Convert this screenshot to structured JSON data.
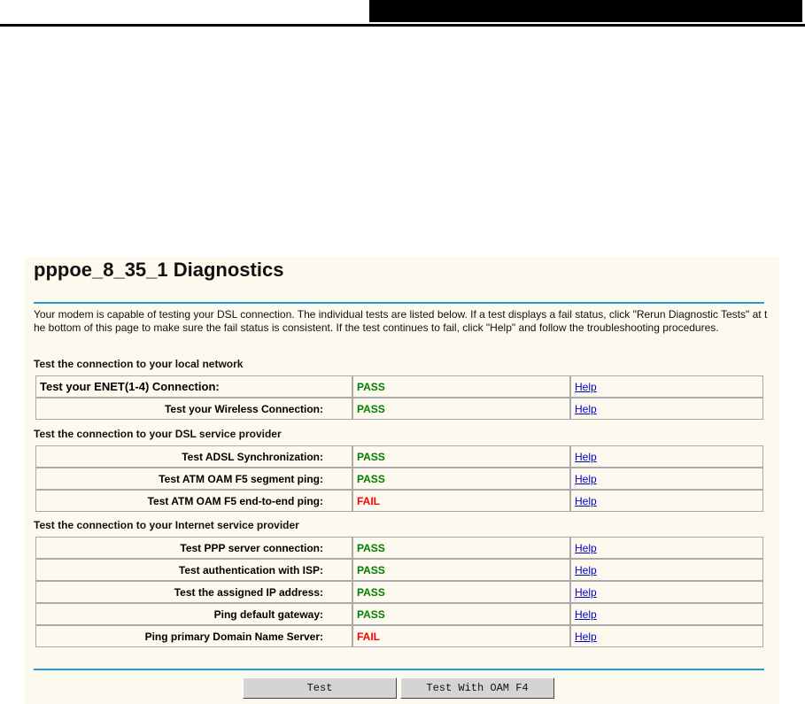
{
  "title": "pppoe_8_35_1 Diagnostics",
  "intro": "Your modem is capable of testing your DSL connection. The individual tests are listed below. If a test displays a fail status, click \"Rerun Diagnostic Tests\" at the bottom of this page to make sure the fail status is consistent. If the test continues to fail, click \"Help\" and follow the troubleshooting procedures.",
  "sections": [
    {
      "heading": "Test the connection to your local network",
      "rows": [
        {
          "label": "Test your ENET(1-4) Connection:",
          "status": "PASS",
          "help": "Help"
        },
        {
          "label": "Test your Wireless Connection:",
          "status": "PASS",
          "help": "Help"
        }
      ]
    },
    {
      "heading": "Test the connection to your DSL service provider",
      "rows": [
        {
          "label": "Test ADSL Synchronization:",
          "status": "PASS",
          "help": "Help"
        },
        {
          "label": "Test ATM OAM F5 segment ping:",
          "status": "PASS",
          "help": "Help"
        },
        {
          "label": "Test ATM OAM F5 end-to-end ping:",
          "status": "FAIL",
          "help": "Help"
        }
      ]
    },
    {
      "heading": "Test the connection to your Internet service provider",
      "rows": [
        {
          "label": "Test PPP server connection:",
          "status": "PASS",
          "help": "Help"
        },
        {
          "label": "Test authentication with ISP:",
          "status": "PASS",
          "help": "Help"
        },
        {
          "label": "Test the assigned IP address:",
          "status": "PASS",
          "help": "Help"
        },
        {
          "label": "Ping default gateway:",
          "status": "PASS",
          "help": "Help"
        },
        {
          "label": "Ping primary Domain Name Server:",
          "status": "FAIL",
          "help": "Help"
        }
      ]
    }
  ],
  "buttons": {
    "test": "Test",
    "test_oam": "Test With OAM F4"
  },
  "colors": {
    "pass": "#008000",
    "fail": "#ff0000",
    "rule": "#1a9ed8"
  }
}
